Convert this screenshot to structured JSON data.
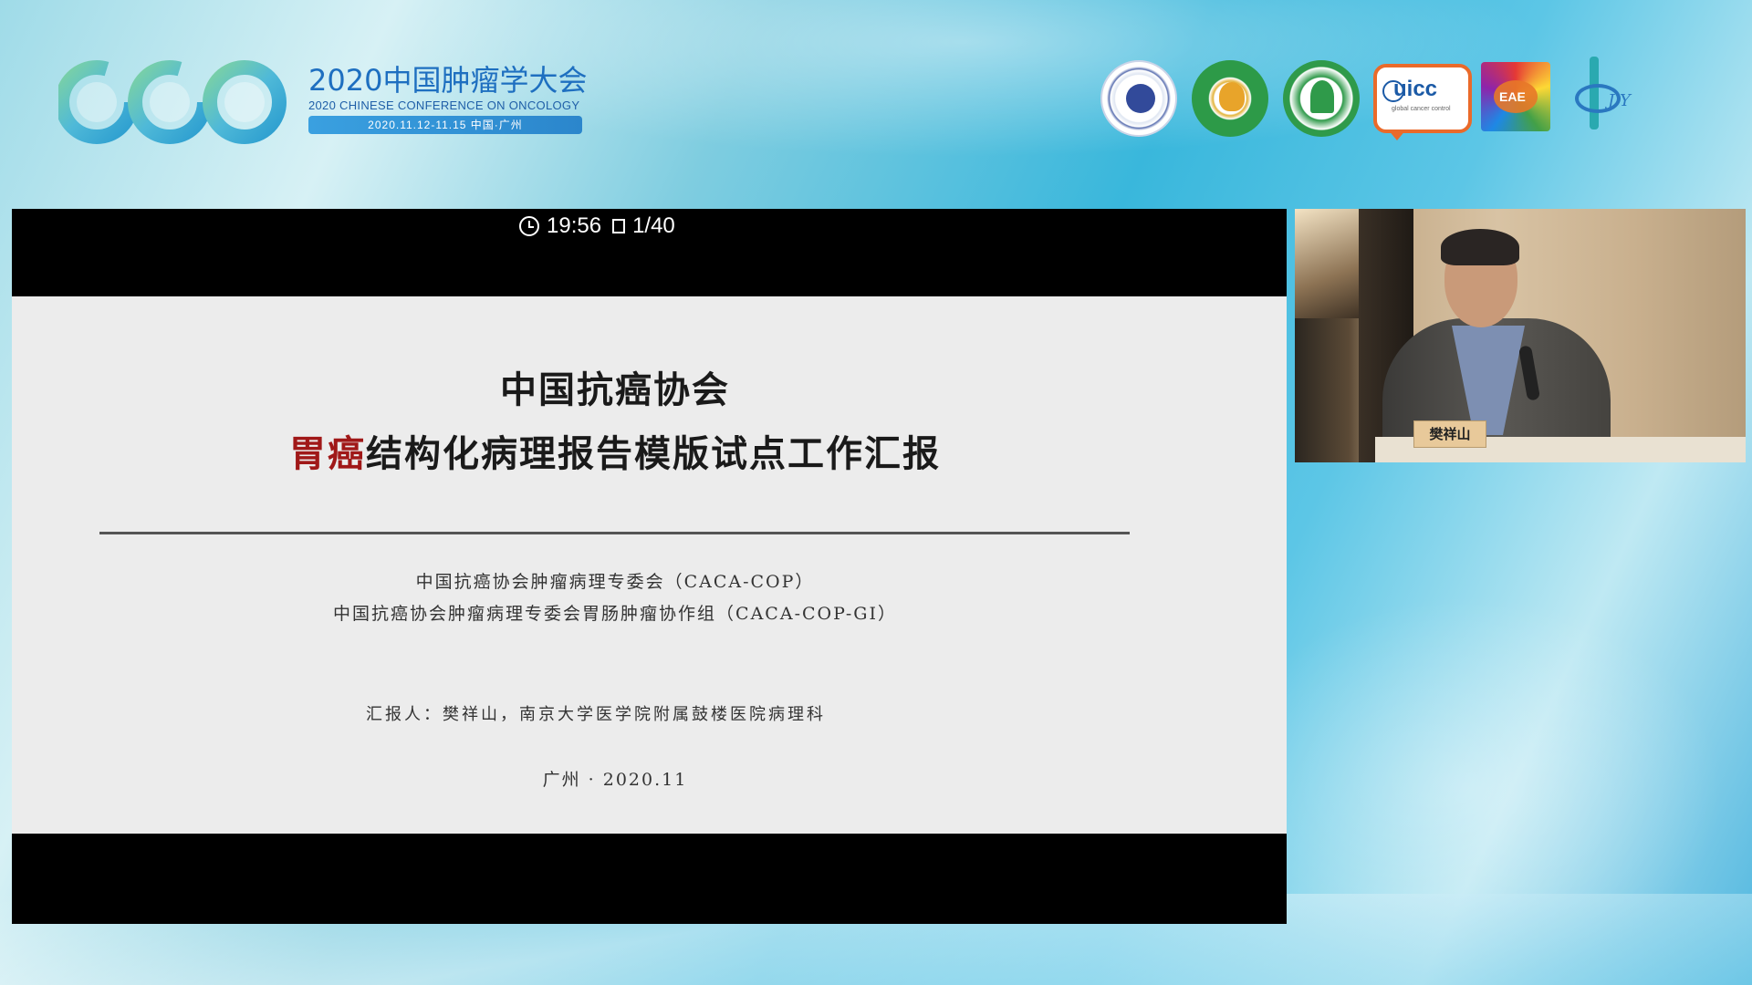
{
  "conference": {
    "title_cn": "2020中国肿瘤学大会",
    "title_en": "2020 CHINESE CONFERENCE ON ONCOLOGY",
    "date_location": "2020.11.12-11.15 中国·广州",
    "logo_icon": "cco-logo-icon"
  },
  "partner_logos": [
    {
      "name": "caca-seal-icon"
    },
    {
      "name": "green-association-emblem-icon"
    },
    {
      "name": "green-circle-emblem-icon"
    },
    {
      "name": "uicc-logo-icon",
      "text": "uicc",
      "sub": "global cancer control"
    },
    {
      "name": "tsidic-eae-logo-icon",
      "text": "EAE"
    },
    {
      "name": "guangzhou-tower-logo-icon",
      "text": "J Y"
    }
  ],
  "player": {
    "time": "19:56",
    "page": "1/40"
  },
  "slide": {
    "title_line1": "中国抗癌协会",
    "title_line2_red": "胃癌",
    "title_line2_rest": "结构化病理报告模版试点工作汇报",
    "org_line1": "中国抗癌协会肿瘤病理专委会（CACA-COP）",
    "org_line2": "中国抗癌协会肿瘤病理专委会胃肠肿瘤协作组（CACA-COP-GI）",
    "reporter": "汇报人：樊祥山，南京大学医学院附属鼓楼医院病理科",
    "place_date": "广州 · 2020.11"
  },
  "speaker": {
    "nameplate": "樊祥山"
  },
  "colors": {
    "accent_red": "#a01818",
    "brand_blue": "#1e6fc0"
  }
}
